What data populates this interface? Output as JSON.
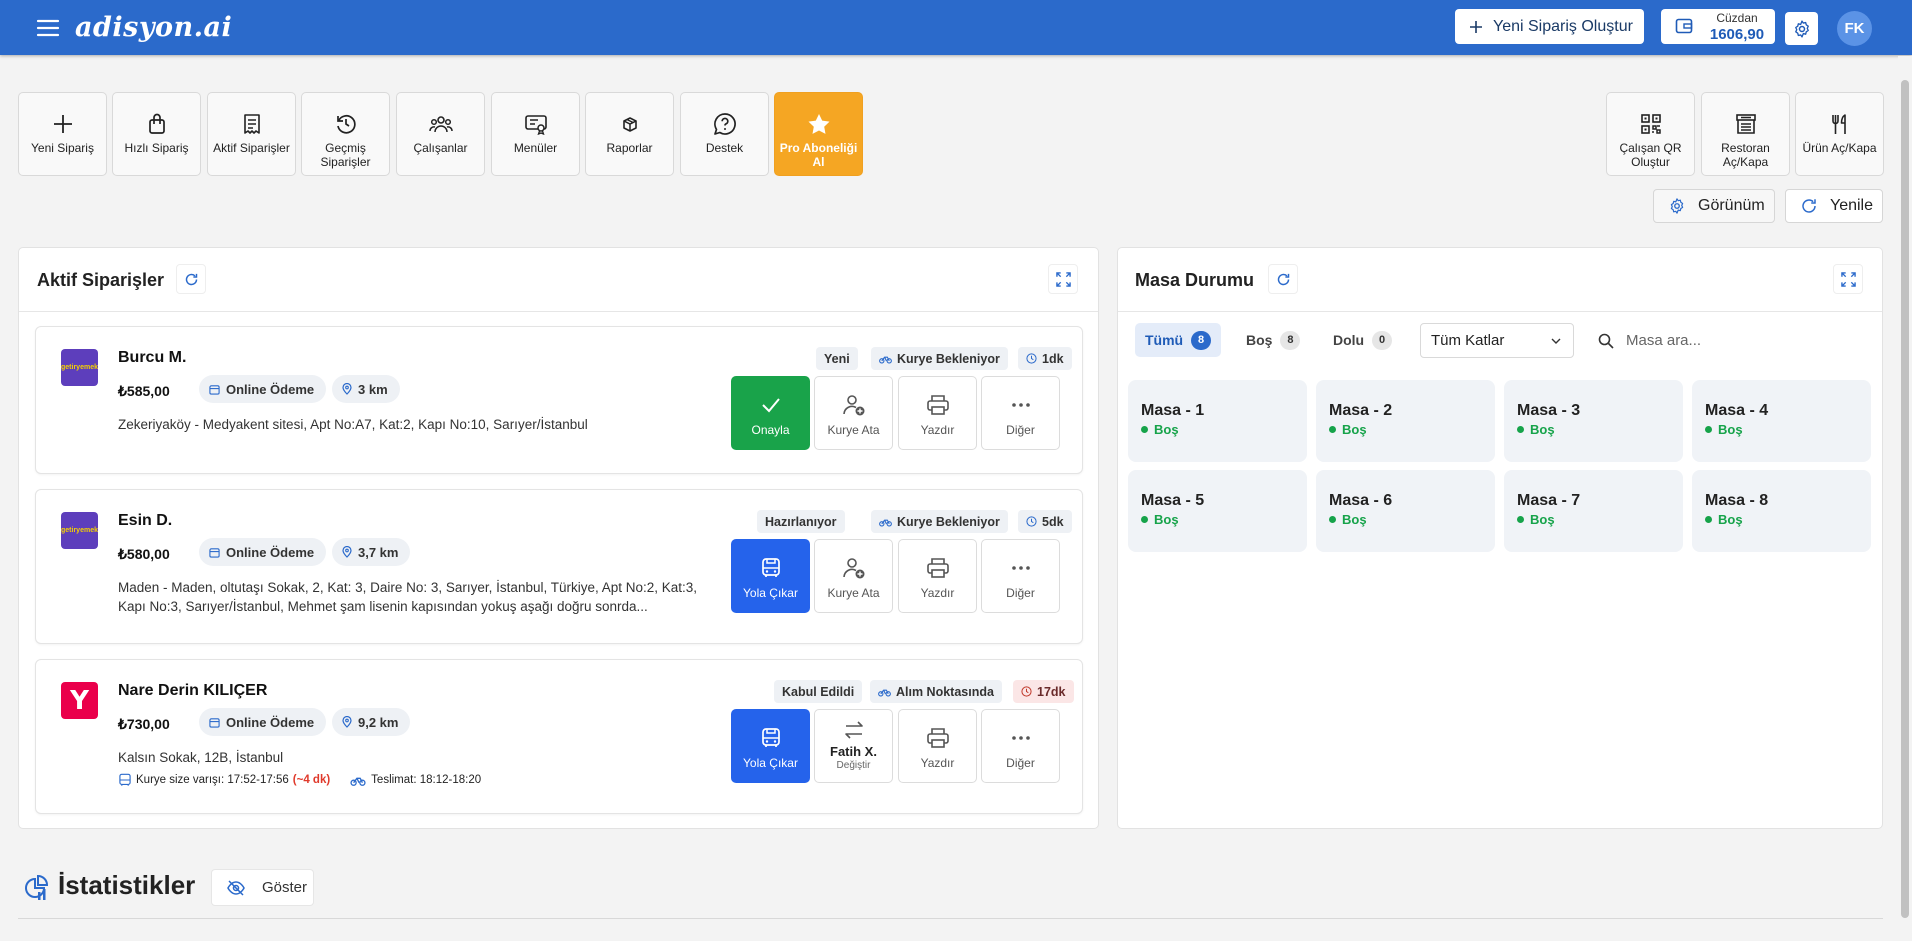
{
  "app": {
    "logo": "adisyon.ai"
  },
  "header": {
    "new_order_label": "Yeni Sipariş Oluştur",
    "wallet_label": "Cüzdan",
    "wallet_value": "1606,90",
    "avatar_initials": "FK"
  },
  "quick_actions": [
    {
      "label": "Yeni Sipariş",
      "icon": "plus-icon"
    },
    {
      "label": "Hızlı Sipariş",
      "icon": "bag-icon"
    },
    {
      "label": "Aktif Siparişler",
      "icon": "receipt-icon"
    },
    {
      "label": "Geçmiş Siparişler",
      "icon": "history-icon"
    },
    {
      "label": "Çalışanlar",
      "icon": "users-icon"
    },
    {
      "label": "Menüler",
      "icon": "menu-card-icon"
    },
    {
      "label": "Raporlar",
      "icon": "box-icon"
    },
    {
      "label": "Destek",
      "icon": "help-icon"
    },
    {
      "label": "Pro Aboneliği Al",
      "icon": "star-icon"
    }
  ],
  "right_actions": [
    {
      "label": "Çalışan QR Oluştur",
      "icon": "qr-icon"
    },
    {
      "label": "Restoran Aç/Kapa",
      "icon": "store-icon"
    },
    {
      "label": "Ürün Aç/Kapa",
      "icon": "cutlery-icon"
    }
  ],
  "view_button": "Görünüm",
  "refresh_button": "Yenile",
  "active_orders": {
    "title": "Aktif Siparişler",
    "orders": [
      {
        "name": "Burcu M.",
        "brand": "getiryemek",
        "price": "₺585,00",
        "payment": "Online Ödeme",
        "distance": "3 km",
        "address": "Zekeriyaköy - Medyakent sitesi, Apt No:A7, Kat:2, Kapı No:10, Sarıyer/İstanbul",
        "status": "Yeni",
        "courier_status": "Kurye Bekleniyor",
        "time": "1dk",
        "primary_action": "Onayla",
        "courier_action": "Kurye Ata",
        "print_action": "Yazdır",
        "more_action": "Diğer"
      },
      {
        "name": "Esin D.",
        "brand": "getiryemek",
        "price": "₺580,00",
        "payment": "Online Ödeme",
        "distance": "3,7 km",
        "address": "Maden - Maden, oltutaşı Sokak, 2, Kat: 3, Daire No: 3, Sarıyer, İstanbul, Türkiye, Apt No:2, Kat:3, Kapı No:3, Sarıyer/İstanbul, Mehmet şam lisenin kapısından yokuş aşağı doğru sonrda...",
        "status": "Hazırlanıyor",
        "courier_status": "Kurye Bekleniyor",
        "time": "5dk",
        "primary_action": "Yola Çıkar",
        "courier_action": "Kurye Ata",
        "print_action": "Yazdır",
        "more_action": "Diğer"
      },
      {
        "name": "Nare Derin KILIÇER",
        "brand": "Y",
        "price": "₺730,00",
        "payment": "Online Ödeme",
        "distance": "9,2 km",
        "address": "Kalsın Sokak, 12B, İstanbul",
        "courier_arrival_label": "Kurye size varışı: 17:52-17:56",
        "courier_arrival_delta": "(~4 dk)",
        "delivery_label": "Teslimat: 18:12-18:20",
        "status": "Kabul Edildi",
        "courier_status": "Alım Noktasında",
        "time": "17dk",
        "primary_action": "Yola Çıkar",
        "courier_name": "Fatih X.",
        "courier_change": "Değiştir",
        "print_action": "Yazdır",
        "more_action": "Diğer"
      }
    ]
  },
  "tables": {
    "title": "Masa Durumu",
    "filters": [
      {
        "label": "Tümü",
        "count": "8"
      },
      {
        "label": "Boş",
        "count": "8"
      },
      {
        "label": "Dolu",
        "count": "0"
      }
    ],
    "floor_select": "Tüm Katlar",
    "search_placeholder": "Masa ara...",
    "items": [
      {
        "name": "Masa - 1",
        "status": "Boş"
      },
      {
        "name": "Masa - 2",
        "status": "Boş"
      },
      {
        "name": "Masa - 3",
        "status": "Boş"
      },
      {
        "name": "Masa - 4",
        "status": "Boş"
      },
      {
        "name": "Masa - 5",
        "status": "Boş"
      },
      {
        "name": "Masa - 6",
        "status": "Boş"
      },
      {
        "name": "Masa - 7",
        "status": "Boş"
      },
      {
        "name": "Masa - 8",
        "status": "Boş"
      }
    ]
  },
  "stats": {
    "title": "İstatistikler",
    "show_button": "Göster"
  },
  "colors": {
    "header": "#2b6acb",
    "approve": "#19a34a",
    "dispatch": "#2563eb",
    "pro": "#f5a623",
    "empty_status": "#16a34a"
  }
}
